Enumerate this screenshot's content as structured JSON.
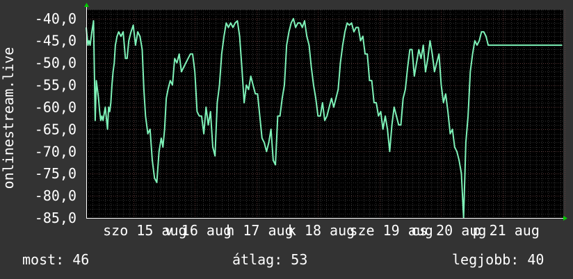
{
  "chart_data": {
    "type": "line",
    "ylabel": "onlinestream.live",
    "xlabel": "",
    "title": "",
    "ylim": [
      -85,
      -38
    ],
    "xlim": [
      0,
      8.52
    ],
    "y_ticks": [
      {
        "value": -40,
        "label": "-40,0"
      },
      {
        "value": -45,
        "label": "-45,0"
      },
      {
        "value": -50,
        "label": "-50,0"
      },
      {
        "value": -55,
        "label": "-55,0"
      },
      {
        "value": -60,
        "label": "-60,0"
      },
      {
        "value": -65,
        "label": "-65,0"
      },
      {
        "value": -70,
        "label": "-70,0"
      },
      {
        "value": -75,
        "label": "-75,0"
      },
      {
        "value": -80,
        "label": "-80,0"
      },
      {
        "value": -85,
        "label": "-85,0"
      }
    ],
    "x_ticks": [
      {
        "value": 0.3,
        "label": "szo 15 aug"
      },
      {
        "value": 1.4,
        "label": "v 16 aug"
      },
      {
        "value": 2.5,
        "label": "h 17 aug"
      },
      {
        "value": 3.6,
        "label": "k 18 aug"
      },
      {
        "value": 4.7,
        "label": "sze 19 aug"
      },
      {
        "value": 5.8,
        "label": "cs 20 aug"
      },
      {
        "value": 6.9,
        "label": "p 21 aug"
      }
    ],
    "grid": true,
    "colors": {
      "background": "#333333",
      "plot_background": "#000000",
      "line": "#7ef2b8",
      "grid_minor": "#333333",
      "grid_major": "#603c3c",
      "axis_arrow": "#00cc00",
      "text": "#ffffff"
    },
    "series": [
      {
        "x": [
          0.0,
          0.03,
          0.05,
          0.07,
          0.1,
          0.13,
          0.16,
          0.18,
          0.2,
          0.22,
          0.24,
          0.26,
          0.28,
          0.3,
          0.34,
          0.38,
          0.4,
          0.42,
          0.44,
          0.46,
          0.48,
          0.5,
          0.52,
          0.55,
          0.58,
          0.62,
          0.66,
          0.7,
          0.73,
          0.76,
          0.8,
          0.84,
          0.88,
          0.92,
          0.96,
          1.0,
          1.03,
          1.06,
          1.1,
          1.14,
          1.18,
          1.22,
          1.26,
          1.3,
          1.34,
          1.37,
          1.4,
          1.43,
          1.46,
          1.5,
          1.54,
          1.58,
          1.62,
          1.66,
          1.7,
          1.74,
          1.78,
          1.82,
          1.86,
          1.9,
          1.94,
          1.98,
          2.02,
          2.06,
          2.1,
          2.14,
          2.18,
          2.22,
          2.26,
          2.3,
          2.34,
          2.38,
          2.42,
          2.46,
          2.5,
          2.54,
          2.58,
          2.62,
          2.66,
          2.7,
          2.74,
          2.78,
          2.82,
          2.86,
          2.9,
          2.94,
          2.98,
          3.02,
          3.06,
          3.1,
          3.14,
          3.18,
          3.22,
          3.26,
          3.3,
          3.34,
          3.38,
          3.42,
          3.46,
          3.5,
          3.54,
          3.58,
          3.62,
          3.66,
          3.7,
          3.74,
          3.78,
          3.82,
          3.86,
          3.9,
          3.94,
          3.98,
          4.02,
          4.06,
          4.1,
          4.14,
          4.18,
          4.22,
          4.26,
          4.3,
          4.34,
          4.38,
          4.42,
          4.46,
          4.5,
          4.54,
          4.58,
          4.62,
          4.66,
          4.7,
          4.74,
          4.78,
          4.82,
          4.86,
          4.9,
          4.94,
          4.98,
          5.02,
          5.06,
          5.1,
          5.14,
          5.18,
          5.22,
          5.26,
          5.3,
          5.34,
          5.38,
          5.42,
          5.46,
          5.5,
          5.54,
          5.58,
          5.62,
          5.66,
          5.7,
          5.74,
          5.78,
          5.82,
          5.86,
          5.9,
          5.94,
          5.98,
          6.02,
          6.06,
          6.1,
          6.14,
          6.18,
          6.22,
          6.26,
          6.3,
          6.34,
          6.38,
          6.42,
          6.46,
          6.5,
          6.54,
          6.58,
          6.62,
          6.66,
          6.7,
          6.74,
          6.78,
          6.82,
          6.86,
          6.9,
          6.94,
          6.98,
          7.02,
          7.06,
          7.1,
          7.14,
          7.18,
          7.22,
          7.26,
          7.3,
          7.34,
          7.38,
          7.42,
          7.46,
          7.5,
          7.54,
          7.58,
          7.62,
          7.66,
          7.7,
          7.74,
          7.78,
          7.82,
          7.86,
          7.9,
          7.94,
          7.98,
          8.02,
          8.06,
          8.1,
          8.14,
          8.18,
          8.22,
          8.26,
          8.3,
          8.34,
          8.38,
          8.42,
          8.46,
          8.5
        ],
        "values": [
          -42,
          -46,
          -45,
          -46,
          -43,
          -40.5,
          -63,
          -54,
          -56,
          -58,
          -61,
          -63,
          -62,
          -63,
          -60,
          -65,
          -60,
          -61,
          -59,
          -55,
          -52,
          -50,
          -46,
          -44,
          -43,
          -44,
          -43,
          -49,
          -49,
          -45,
          -43,
          -41.5,
          -46,
          -43,
          -44,
          -47,
          -56,
          -62,
          -66,
          -65,
          -72,
          -76,
          -77,
          -70,
          -67,
          -69,
          -65,
          -58,
          -56,
          -54,
          -55,
          -49,
          -50,
          -48,
          -52,
          -51,
          -50,
          -49,
          -48,
          -48,
          -52,
          -61,
          -62,
          -62,
          -66,
          -60,
          -64,
          -61,
          -69,
          -71,
          -59,
          -55,
          -48,
          -44,
          -41,
          -42,
          -41,
          -42,
          -41,
          -40.5,
          -44,
          -51,
          -59,
          -55,
          -56,
          -53,
          -55,
          -57,
          -57,
          -62,
          -67,
          -68,
          -70,
          -68,
          -65,
          -72,
          -73,
          -62,
          -62,
          -58,
          -55,
          -46,
          -43,
          -41,
          -40,
          -42,
          -41,
          -41,
          -42,
          -40.5,
          -44,
          -46,
          -51,
          -55,
          -58,
          -62,
          -62,
          -59,
          -63,
          -62,
          -60,
          -58,
          -60,
          -58,
          -56,
          -50,
          -46,
          -43,
          -41,
          -41.5,
          -41,
          -43,
          -42,
          -42,
          -45,
          -44,
          -48,
          -48,
          -54,
          -54,
          -59,
          -59,
          -62,
          -61,
          -65,
          -62,
          -65,
          -70,
          -64,
          -60,
          -62,
          -64,
          -64,
          -58,
          -56,
          -51,
          -47,
          -47,
          -53,
          -50,
          -47,
          -49,
          -46,
          -52,
          -49,
          -45,
          -48,
          -52,
          -50,
          -48,
          -55,
          -59,
          -57,
          -61,
          -66,
          -65,
          -69,
          -70,
          -72,
          -75,
          -85,
          -68,
          -62,
          -52,
          -48,
          -45,
          -46,
          -45,
          -43,
          -43,
          -44,
          -46,
          -46,
          -46,
          -46,
          -46,
          -46,
          -46,
          -46,
          -46,
          -46,
          -46,
          -46,
          -46,
          -46,
          -46,
          -46,
          -46,
          -46,
          -46,
          -46,
          -46,
          -46,
          -46,
          -46,
          -46,
          -46,
          -46,
          -46,
          -46,
          -46,
          -46,
          -46,
          -46,
          -46
        ]
      }
    ]
  },
  "stats": {
    "now": "most: 46",
    "avg": "átlag: 53",
    "best": "legjobb: 40"
  }
}
